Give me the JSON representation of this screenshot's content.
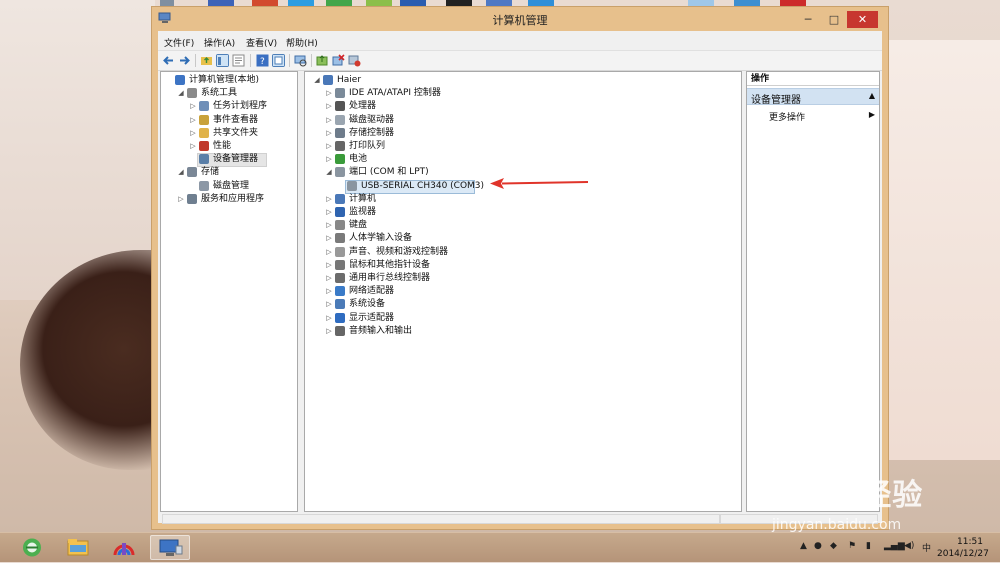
{
  "window": {
    "title": "计算机管理",
    "min": "─",
    "max": "□",
    "close": "✕"
  },
  "menu": [
    "文件(F)",
    "操作(A)",
    "查看(V)",
    "帮助(H)"
  ],
  "toolbar_icons": [
    "back-icon",
    "forward-icon",
    "up-icon",
    "show-hide-tree-icon",
    "properties-icon",
    "help-icon",
    "console-icon",
    "update-driver-icon",
    "uninstall-icon",
    "scan-hardware-icon"
  ],
  "left_tree": [
    {
      "label": "计算机管理(本地)",
      "expander": "",
      "level": 0,
      "icon": "computer-management-icon"
    },
    {
      "label": "系统工具",
      "expander": "◢",
      "level": 1,
      "icon": "tools-icon"
    },
    {
      "label": "任务计划程序",
      "expander": "▷",
      "level": 2,
      "icon": "task-scheduler-icon"
    },
    {
      "label": "事件查看器",
      "expander": "▷",
      "level": 2,
      "icon": "event-viewer-icon"
    },
    {
      "label": "共享文件夹",
      "expander": "▷",
      "level": 2,
      "icon": "shared-folder-icon"
    },
    {
      "label": "性能",
      "expander": "▷",
      "level": 2,
      "icon": "performance-icon"
    },
    {
      "label": "设备管理器",
      "expander": "",
      "level": 2,
      "icon": "device-manager-icon",
      "selected": true
    },
    {
      "label": "存储",
      "expander": "◢",
      "level": 1,
      "icon": "storage-icon"
    },
    {
      "label": "磁盘管理",
      "expander": "",
      "level": 2,
      "icon": "disk-management-icon"
    },
    {
      "label": "服务和应用程序",
      "expander": "▷",
      "level": 1,
      "icon": "services-icon"
    }
  ],
  "device_tree": [
    {
      "label": "Haier",
      "expander": "◢",
      "level": 0,
      "icon": "computer-icon"
    },
    {
      "label": "IDE ATA/ATAPI 控制器",
      "expander": "▷",
      "level": 1,
      "icon": "ide-controller-icon"
    },
    {
      "label": "处理器",
      "expander": "▷",
      "level": 1,
      "icon": "processor-icon"
    },
    {
      "label": "磁盘驱动器",
      "expander": "▷",
      "level": 1,
      "icon": "disk-drive-icon"
    },
    {
      "label": "存储控制器",
      "expander": "▷",
      "level": 1,
      "icon": "storage-controller-icon"
    },
    {
      "label": "打印队列",
      "expander": "▷",
      "level": 1,
      "icon": "printer-icon"
    },
    {
      "label": "电池",
      "expander": "▷",
      "level": 1,
      "icon": "battery-icon"
    },
    {
      "label": "端口 (COM 和 LPT)",
      "expander": "◢",
      "level": 1,
      "icon": "port-icon"
    },
    {
      "label": "USB-SERIAL CH340 (COM3)",
      "expander": "",
      "level": 2,
      "icon": "serial-port-icon",
      "selected": true
    },
    {
      "label": "计算机",
      "expander": "▷",
      "level": 1,
      "icon": "computer-icon"
    },
    {
      "label": "监视器",
      "expander": "▷",
      "level": 1,
      "icon": "monitor-icon"
    },
    {
      "label": "键盘",
      "expander": "▷",
      "level": 1,
      "icon": "keyboard-icon"
    },
    {
      "label": "人体学输入设备",
      "expander": "▷",
      "level": 1,
      "icon": "hid-icon"
    },
    {
      "label": "声音、视频和游戏控制器",
      "expander": "▷",
      "level": 1,
      "icon": "sound-icon"
    },
    {
      "label": "鼠标和其他指针设备",
      "expander": "▷",
      "level": 1,
      "icon": "mouse-icon"
    },
    {
      "label": "通用串行总线控制器",
      "expander": "▷",
      "level": 1,
      "icon": "usb-controller-icon"
    },
    {
      "label": "网络适配器",
      "expander": "▷",
      "level": 1,
      "icon": "network-adapter-icon"
    },
    {
      "label": "系统设备",
      "expander": "▷",
      "level": 1,
      "icon": "system-device-icon"
    },
    {
      "label": "显示适配器",
      "expander": "▷",
      "level": 1,
      "icon": "display-adapter-icon"
    },
    {
      "label": "音频输入和输出",
      "expander": "▷",
      "level": 1,
      "icon": "audio-io-icon"
    }
  ],
  "actions": {
    "header": "操作",
    "section": "设备管理器",
    "section_arrow": "▲",
    "more": "更多操作",
    "more_arrow": "▶"
  },
  "taskbar": {
    "apps": [
      "ie-icon",
      "file-explorer-icon",
      "app-icon",
      "computer-management-icon"
    ],
    "tray_lang": "中",
    "time": "11:51",
    "date": "2014/12/27"
  },
  "watermark": {
    "brand": "Baidu经验",
    "url": "jingyan.baidu.com"
  },
  "colors": {
    "title_bar": "#e7c08c",
    "close_button": "#c7372f",
    "selection": "#dbe9f6",
    "actions_section": "#d2e2f2",
    "annotation_arrow": "#e0342a"
  }
}
